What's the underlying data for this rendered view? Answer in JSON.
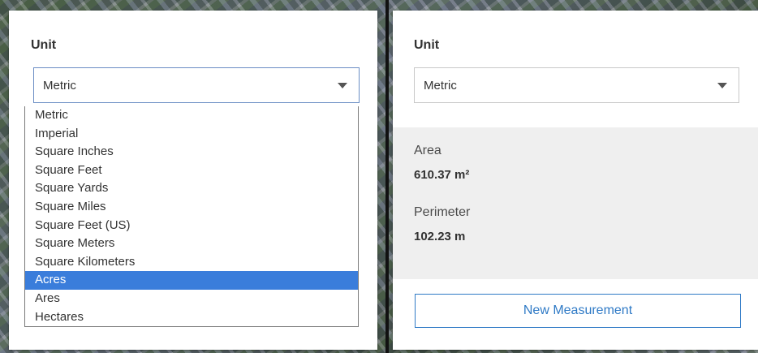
{
  "left_panel": {
    "unit_label": "Unit",
    "select_value": "Metric",
    "options": [
      "Metric",
      "Imperial",
      "Square Inches",
      "Square Feet",
      "Square Yards",
      "Square Miles",
      "Square Feet (US)",
      "Square Meters",
      "Square Kilometers",
      "Acres",
      "Ares",
      "Hectares"
    ],
    "highlighted_option": "Acres"
  },
  "right_panel": {
    "unit_label": "Unit",
    "select_value": "Metric",
    "area_label": "Area",
    "area_value": "610.37 m²",
    "perimeter_label": "Perimeter",
    "perimeter_value": "102.23 m",
    "new_measurement_label": "New Measurement"
  },
  "colors": {
    "accent": "#2f7ac6",
    "highlight": "#3a7ddb",
    "results_bg": "#efefef"
  },
  "icons": {
    "select_caret": "caret-down-icon"
  }
}
